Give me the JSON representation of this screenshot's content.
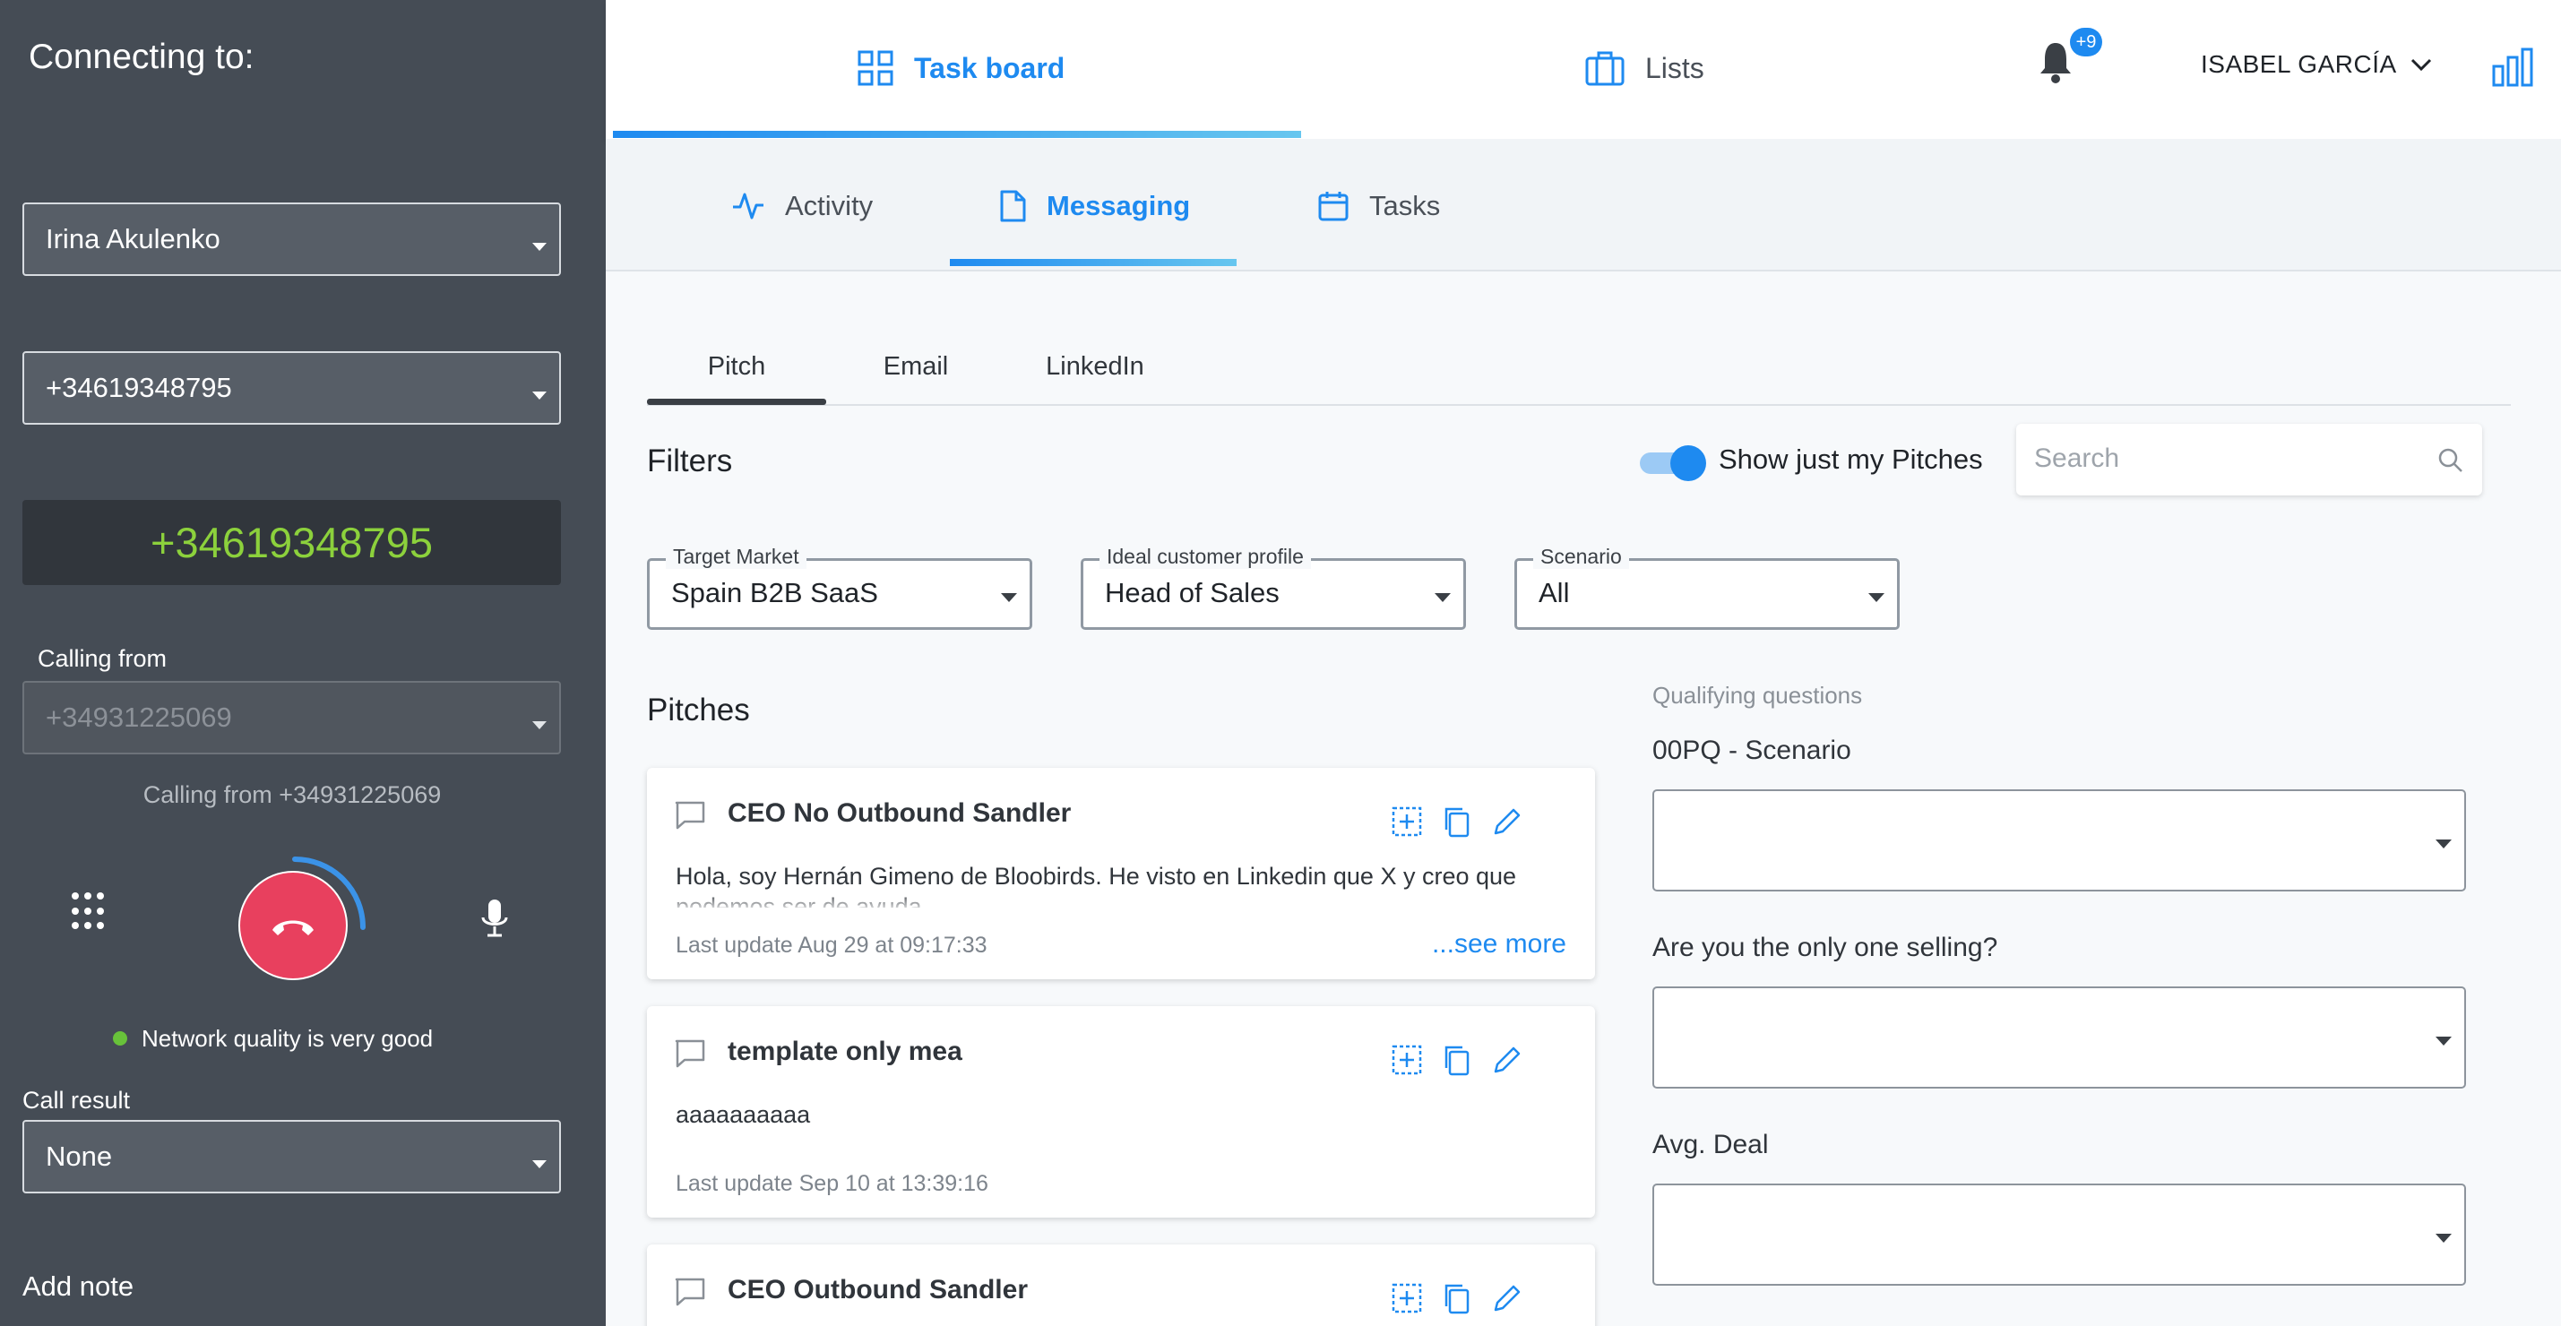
{
  "dialer": {
    "title": "Connecting to:",
    "contact": "Irina Akulenko",
    "phone": "+34619348795",
    "dialed_number": "+34619348795",
    "calling_from_label": "Calling from",
    "calling_from_value": "+34931225069",
    "calling_from_text": "Calling from +34931225069",
    "network_quality": "Network quality is very good",
    "call_result_label": "Call result",
    "call_result_value": "None",
    "add_note": "Add note",
    "colors": {
      "panel": "#454c55",
      "dialed_number": "#8cd13c",
      "hangup": "#e8405e",
      "network_ok": "#68c23a"
    }
  },
  "topnav": {
    "tabs": [
      {
        "label": "Task board",
        "icon": "grid-icon",
        "active": true
      },
      {
        "label": "Lists",
        "icon": "briefcase-icon",
        "active": false
      }
    ],
    "notifications_badge": "+9",
    "user_name": "ISABEL GARCÍA",
    "accent": "#1e8af0"
  },
  "subnav": {
    "tabs": [
      {
        "label": "Activity",
        "icon": "activity-icon",
        "active": false
      },
      {
        "label": "Messaging",
        "icon": "document-icon",
        "active": true
      },
      {
        "label": "Tasks",
        "icon": "calendar-icon",
        "active": false
      }
    ]
  },
  "messaging": {
    "tabs": [
      "Pitch",
      "Email",
      "LinkedIn"
    ],
    "active_tab": "Pitch",
    "filters_label": "Filters",
    "toggle_label": "Show just my Pitches",
    "toggle_on": true,
    "search_placeholder": "Search",
    "filters": [
      {
        "label": "Target Market",
        "value": "Spain B2B SaaS"
      },
      {
        "label": "Ideal customer profile",
        "value": "Head of Sales"
      },
      {
        "label": "Scenario",
        "value": "All"
      }
    ],
    "pitches_label": "Pitches",
    "pitches": [
      {
        "title": "CEO No Outbound Sandler",
        "body": "Hola, soy Hernán Gimeno de Bloobirds. He visto en Linkedin que X y creo que podemos ser de ayuda.",
        "updated": "Last update Aug 29 at 09:17:33",
        "see_more": "...see more"
      },
      {
        "title": "template only mea",
        "body": "aaaaaaaaaa",
        "updated": "Last update Sep 10 at 13:39:16"
      },
      {
        "title": "CEO Outbound Sandler"
      }
    ],
    "qualifying": {
      "label": "Qualifying questions",
      "questions": [
        {
          "label": "00PQ - Scenario",
          "value": ""
        },
        {
          "label": "Are you the only one selling?",
          "value": ""
        },
        {
          "label": "Avg. Deal",
          "value": ""
        }
      ]
    }
  }
}
